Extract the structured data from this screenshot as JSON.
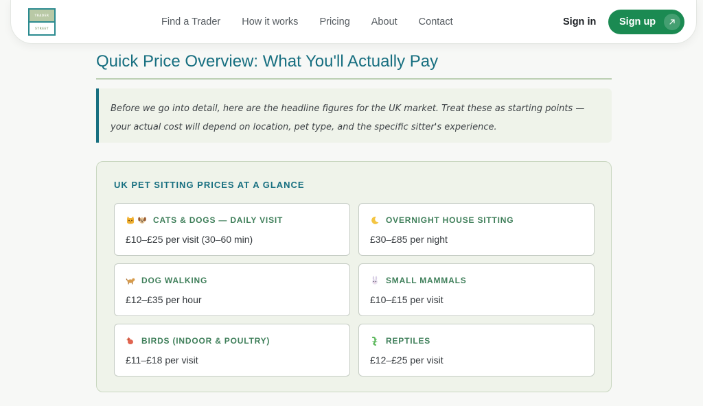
{
  "logo": {
    "top_text": "TRADER",
    "bottom_text": "STREET"
  },
  "nav": {
    "links": [
      "Find a Trader",
      "How it works",
      "Pricing",
      "About",
      "Contact"
    ],
    "signin_label": "Sign in",
    "signup_label": "Sign up"
  },
  "section": {
    "heading": "Quick Price Overview: What You'll Actually Pay",
    "callout_line1": "Before we go into detail, here are the headline figures for the UK market. Treat these as starting points —",
    "callout_line2": "your actual cost will depend on location, pet type, and the specific sitter's experience."
  },
  "prices_card": {
    "title": "UK PET SITTING PRICES AT A GLANCE",
    "tiles": [
      {
        "icons": [
          "cat-icon",
          "dog-icon"
        ],
        "label": "CATS & DOGS — DAILY VISIT",
        "value": "£10–£25 per visit (30–60 min)"
      },
      {
        "icons": [
          "moon-icon"
        ],
        "label": "OVERNIGHT HOUSE SITTING",
        "value": "£30–£85 per night"
      },
      {
        "icons": [
          "dog-icon"
        ],
        "label": "DOG WALKING",
        "value": "£12–£35 per hour"
      },
      {
        "icons": [
          "rabbit-icon"
        ],
        "label": "SMALL MAMMALS",
        "value": "£10–£15 per visit"
      },
      {
        "icons": [
          "bird-icon"
        ],
        "label": "BIRDS (INDOOR & POULTRY)",
        "value": "£11–£18 per visit"
      },
      {
        "icons": [
          "lizard-icon"
        ],
        "label": "REPTILES",
        "value": "£12–£25 per visit"
      }
    ]
  },
  "colors": {
    "accent_teal": "#176f80",
    "brand_green": "#1b8a52",
    "tile_label_green": "#3f7f5a",
    "card_bg": "#eff3ea"
  }
}
